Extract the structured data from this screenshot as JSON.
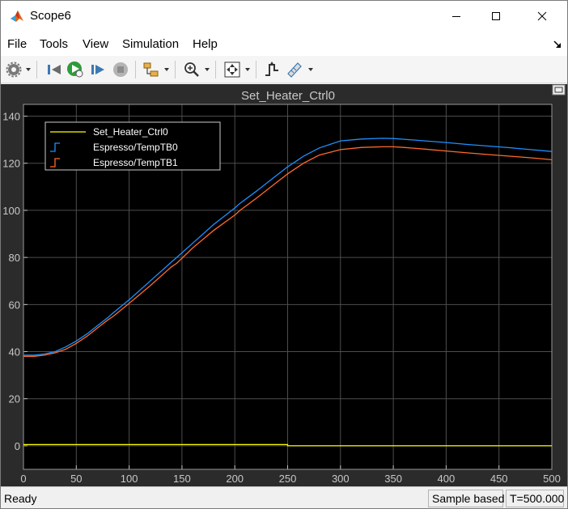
{
  "window": {
    "title": "Scope6"
  },
  "menu": {
    "file": "File",
    "tools": "Tools",
    "view": "View",
    "simulation": "Simulation",
    "help": "Help"
  },
  "toolbar": {
    "icons": [
      "gear-icon",
      "dropdown-arrow-icon",
      "step-back-icon",
      "run-icon",
      "step-forward-icon",
      "stop-icon",
      "highlight-block-icon",
      "dropdown-arrow-icon",
      "zoom-in-icon",
      "dropdown-arrow-icon",
      "fit-to-view-icon",
      "dropdown-arrow-icon",
      "triggers-icon",
      "measurements-icon",
      "dropdown-arrow-icon"
    ]
  },
  "status": {
    "ready": "Ready",
    "mode": "Sample based",
    "time": "T=500.000"
  },
  "colors": {
    "plot_bg": "#000000",
    "figure_bg": "#2b2b2b",
    "grid": "#4d4d4d",
    "series0": "#ffff00",
    "series1": "#1e90ff",
    "series2": "#ff6a2a"
  },
  "chart_data": {
    "type": "line",
    "title": "Set_Heater_Ctrl0",
    "xlim": [
      0,
      500
    ],
    "ylim": [
      -10,
      145
    ],
    "x_ticks": [
      0,
      50,
      100,
      150,
      200,
      250,
      300,
      350,
      400,
      450,
      500
    ],
    "y_ticks": [
      0,
      20,
      40,
      60,
      80,
      100,
      120,
      140
    ],
    "grid": true,
    "legend_position": "top-left",
    "series": [
      {
        "name": "Set_Heater_Ctrl0",
        "color": "#ffff00",
        "x": [
          0,
          250,
          250,
          500
        ],
        "y": [
          0.5,
          0.5,
          0,
          0
        ]
      },
      {
        "name": "Espresso/TempTB0",
        "color": "#1e90ff",
        "x": [
          0,
          10,
          20,
          30,
          40,
          50,
          60,
          70,
          80,
          85,
          100,
          120,
          140,
          145,
          160,
          180,
          200,
          205,
          220,
          240,
          250,
          260,
          265,
          280,
          300,
          320,
          340,
          350,
          360,
          380,
          400,
          420,
          440,
          460,
          480,
          500
        ],
        "y": [
          38.5,
          38.5,
          39,
          40,
          42,
          44.5,
          47.5,
          51,
          54.5,
          56.5,
          62,
          70,
          78,
          80,
          86,
          94,
          101,
          103,
          108,
          115,
          118.5,
          121.5,
          123,
          126.5,
          129.5,
          130.3,
          130.6,
          130.5,
          130.2,
          129.5,
          128.8,
          128,
          127.3,
          126.6,
          125.8,
          125
        ]
      },
      {
        "name": "Espresso/TempTB1",
        "color": "#ff6a2a",
        "x": [
          0,
          10,
          20,
          30,
          40,
          50,
          60,
          70,
          80,
          85,
          100,
          120,
          140,
          145,
          160,
          180,
          200,
          205,
          220,
          240,
          250,
          260,
          265,
          280,
          300,
          320,
          340,
          350,
          360,
          380,
          400,
          420,
          440,
          460,
          480,
          500
        ],
        "y": [
          38,
          38,
          38.5,
          39.5,
          41,
          43.5,
          46.5,
          50,
          53.5,
          55,
          60.5,
          68,
          76,
          77.5,
          84,
          91.5,
          98,
          100,
          105,
          112,
          115.5,
          118.5,
          120,
          123.5,
          125.8,
          126.7,
          127,
          127,
          126.7,
          126,
          125.2,
          124.4,
          123.7,
          123,
          122.3,
          121.5
        ]
      }
    ]
  }
}
